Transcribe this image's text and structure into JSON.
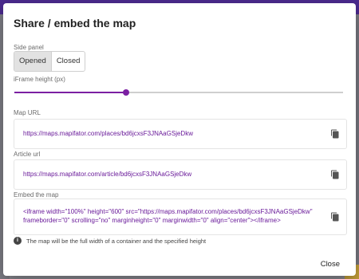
{
  "dialog": {
    "title": "Share / embed the map",
    "side_panel": {
      "label": "Side panel",
      "options": [
        "Opened",
        "Closed"
      ],
      "selected": "Opened"
    },
    "iframe_height": {
      "label": "iFrame height (px)",
      "slider_fraction": 0.34
    },
    "map_url": {
      "label": "Map URL",
      "value": "https://maps.mapifator.com/places/bd6jcxsF3JNAaGSjeDkw"
    },
    "article_url": {
      "label": "Article url",
      "value": "https://maps.mapifator.com/article/bd6jcxsF3JNAaGSjeDkw"
    },
    "embed": {
      "label": "Embed the map",
      "line1": "<iframe width=\"100%\" height=\"600\" src=\"https://maps.mapifator.com/places/bd6jcxsF3JNAaGSjeDkw\"",
      "line2": "frameborder=\"0\" scrolling=\"no\" marginheight=\"0\" marginwidth=\"0\" align=\"center\"></iframe>"
    },
    "note": "The map will be the full width of a container and the specified height",
    "close_label": "Close"
  },
  "colors": {
    "accent": "#7b1fa2",
    "link_text": "#6a1b9a"
  },
  "icons": {
    "copy": "copy-icon",
    "info": "info-icon"
  }
}
